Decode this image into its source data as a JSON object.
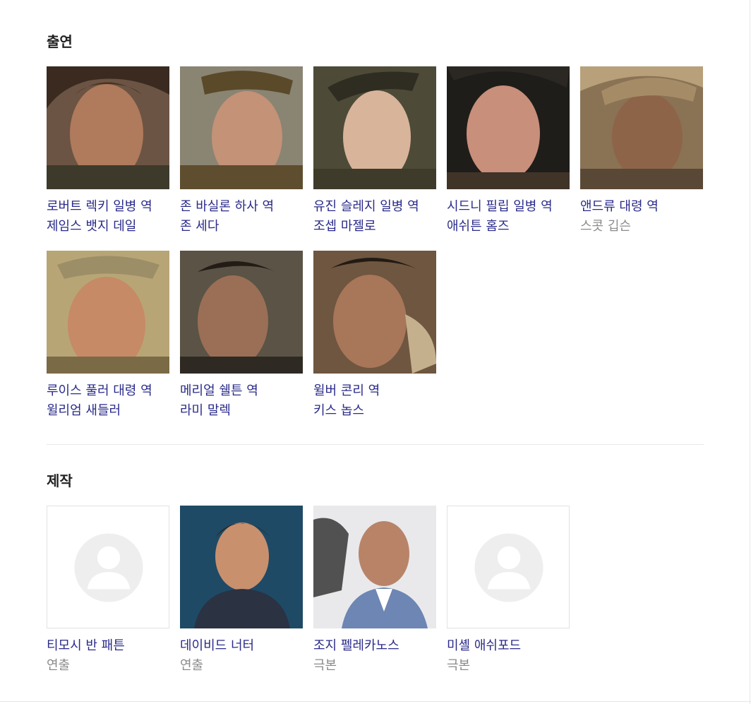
{
  "cast": {
    "title": "출연",
    "items": [
      {
        "role": "로버트 렉키 일병 역",
        "actor": "제임스 뱃지 데일",
        "actor_linked": true
      },
      {
        "role": "존 바실론 하사 역",
        "actor": "존 세다",
        "actor_linked": true
      },
      {
        "role": "유진 슬레지 일병 역",
        "actor": "조셉 마젤로",
        "actor_linked": true
      },
      {
        "role": "시드니 필립 일병 역",
        "actor": "애쉬튼 홈즈",
        "actor_linked": true
      },
      {
        "role": "앤드류 대령 역",
        "actor": "스콧 깁슨",
        "actor_linked": false
      },
      {
        "role": "루이스 풀러 대령 역",
        "actor": "윌리엄 새들러",
        "actor_linked": true
      },
      {
        "role": "메리얼 쉘튼 역",
        "actor": "라미 말렉",
        "actor_linked": true
      },
      {
        "role": "윌버 콘리 역",
        "actor": "키스 놉스",
        "actor_linked": true
      }
    ]
  },
  "crew": {
    "title": "제작",
    "items": [
      {
        "name": "티모시 반 패튼",
        "job": "연출",
        "has_photo": false
      },
      {
        "name": "데이비드 너터",
        "job": "연출",
        "has_photo": true
      },
      {
        "name": "조지 펠레카노스",
        "job": "극본",
        "has_photo": true
      },
      {
        "name": "미셸 애쉬포드",
        "job": "극본",
        "has_photo": false
      }
    ]
  },
  "colors": {
    "link": "#2a2a8a",
    "muted": "#8b8b8b",
    "heading": "#222222",
    "divider": "#e8e8e8"
  },
  "icons": {
    "placeholder": "person-silhouette-icon"
  }
}
